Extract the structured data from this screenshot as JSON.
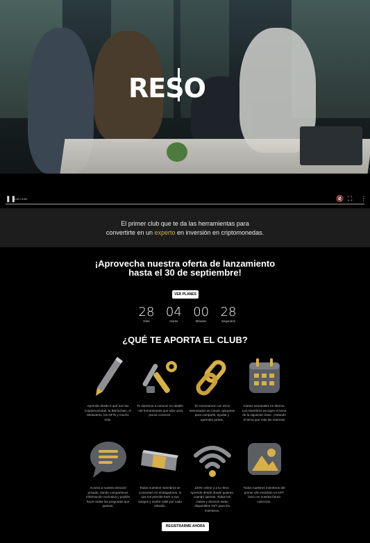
{
  "video": {
    "logo_text": "RESO",
    "time": "0:00 / 0:52",
    "progress": 0.0,
    "controls": [
      "pause-icon",
      "mute-icon",
      "fullscreen-icon",
      "more-icon"
    ]
  },
  "intro": {
    "line1": "El primer club que te da las herramientas para",
    "line2_pre": "convertirte en un ",
    "line2_accent": "experto",
    "line2_post": " en inversión en criptomonedas."
  },
  "offer": {
    "title_line1": "¡Aprovecha nuestra oferta de lanzamiento",
    "title_line2": "hasta el 30 de septiembre!",
    "button": "VER PLANES"
  },
  "countdown": [
    {
      "value": "28",
      "label": "Días"
    },
    {
      "value": "04",
      "label": "Horas"
    },
    {
      "value": "00",
      "label": "Minutos"
    },
    {
      "value": "28",
      "label": "Segundos"
    }
  ],
  "club": {
    "title": "¿QUÉ TE APORTA EL CLUB?",
    "features": [
      {
        "icon": "pencil-icon",
        "text": "Aprende desde 0 qué son las Criptomonedas, la Blockchain, el Metaverso, los NFTs y mucho más."
      },
      {
        "icon": "tools-icon",
        "text": "Te daremos a conocer en detalle +30 herramientas que sólo unos pocos conocen."
      },
      {
        "icon": "chain-link-icon",
        "text": "Te conectamos con otros interesados en crecer, apoyarse para compartir, ayudar y aprender juntos."
      },
      {
        "icon": "calendar-icon",
        "text": "Clases semanales en directo. Los miembros escogen el tema de la siguiente clase. ¡Votando el tema que más les interesa!"
      },
      {
        "icon": "chat-bubble-icon",
        "text": "Acceso a nuestro Discord privado, donde compartimos información exclusiva y podrás hacer todas las preguntas que quieras."
      },
      {
        "icon": "ticket-icon",
        "text": "Todos nuestros miembros se convierten en embajadores, lo que les permite traer a sus amigos y recibir 100€ por cada referido."
      },
      {
        "icon": "wifi-icon",
        "text": "100% online y a tu ritmo. Aprende desde donde quieras, cuando quieras. Todas las clases y directos están disponibles 24/7 para los miembros."
      },
      {
        "icon": "image-icon",
        "text": "Todos nuestros miembros del primer año recibirán un NFT único en nuestra futura colección."
      }
    ],
    "button": "REGISTRARME AHORA"
  },
  "colors": {
    "accent": "#d8b04a",
    "background": "#000000",
    "band": "#1d1d1d"
  }
}
